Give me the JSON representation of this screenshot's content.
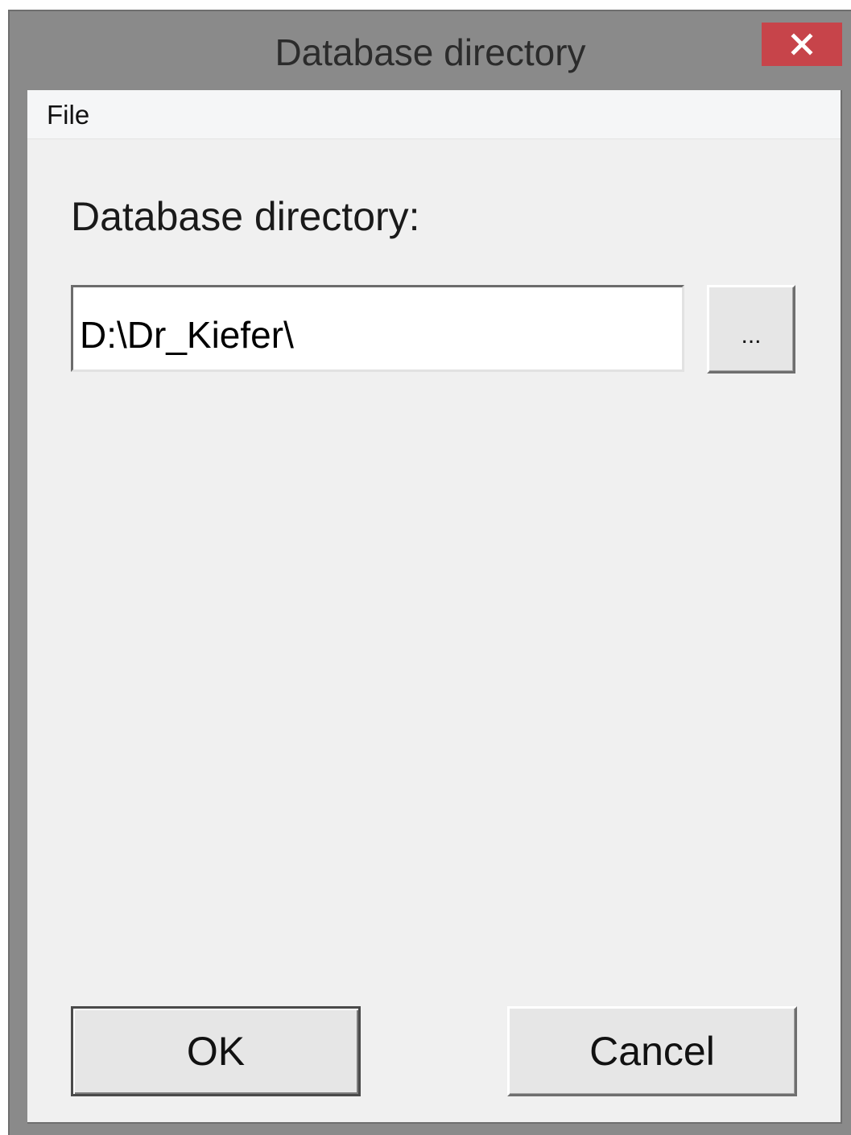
{
  "window": {
    "title": "Database directory",
    "close_icon": "close-icon"
  },
  "menu": {
    "items": [
      {
        "label": "File"
      }
    ]
  },
  "form": {
    "directory_label": "Database directory:",
    "directory_value": "D:\\Dr_Kiefer\\",
    "browse_label": "..."
  },
  "buttons": {
    "ok_label": "OK",
    "cancel_label": "Cancel"
  },
  "colors": {
    "close_button": "#c7444a",
    "window_frame": "#8a8a8a",
    "client_background": "#f0f0f0"
  }
}
